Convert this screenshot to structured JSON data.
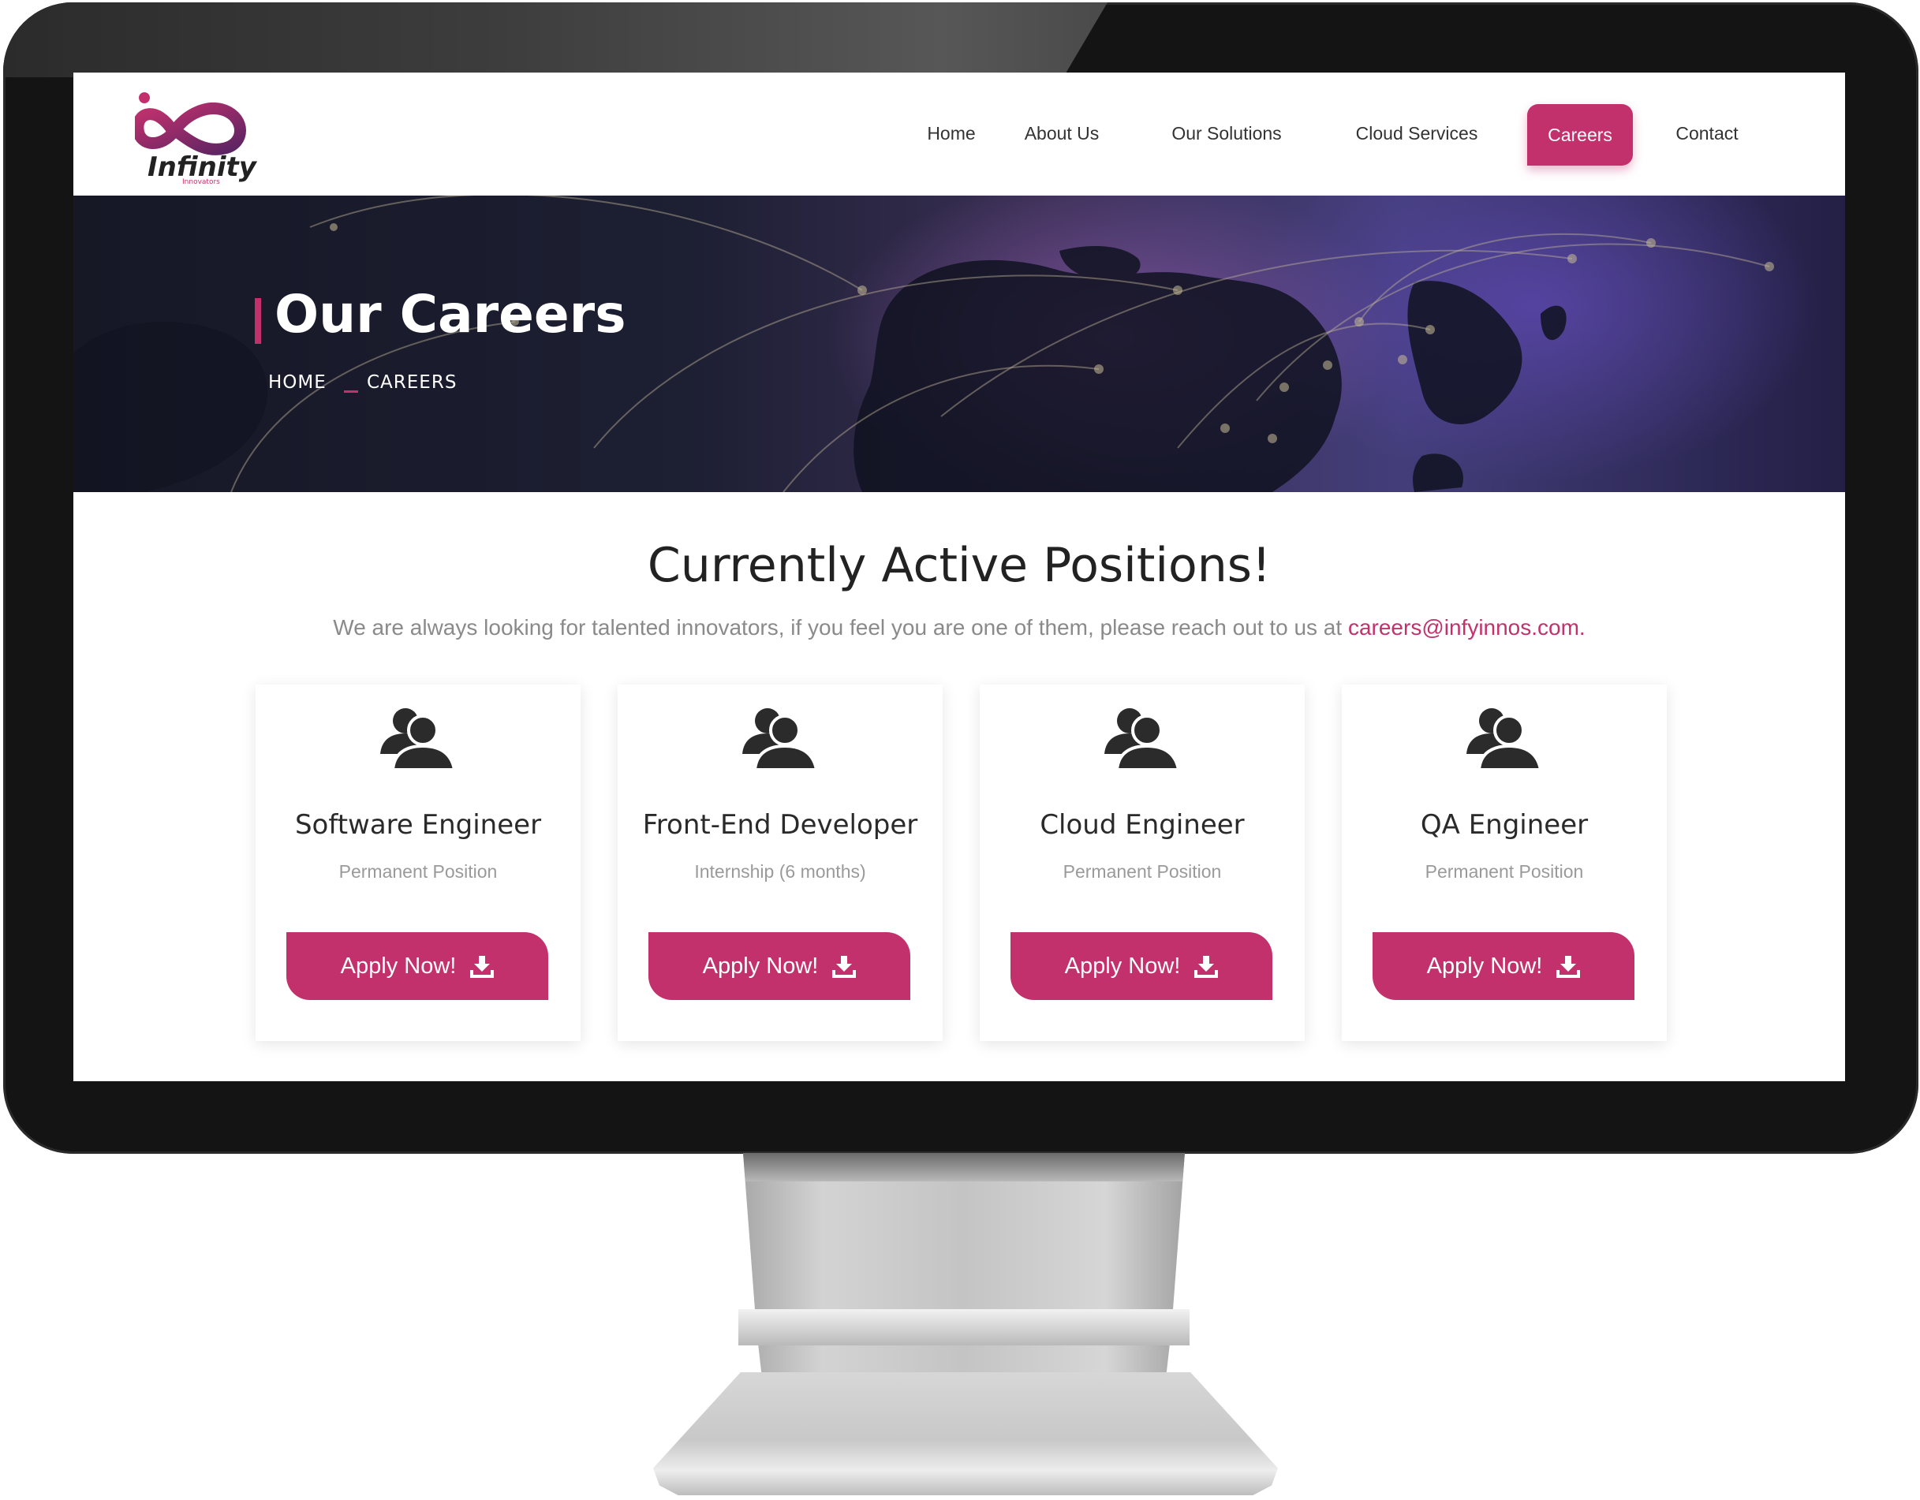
{
  "brand": {
    "name": "Infinity",
    "tagline": "Innovators",
    "accent_color": "#c3316d"
  },
  "nav": {
    "items": [
      {
        "label": "Home"
      },
      {
        "label": "About Us"
      },
      {
        "label": "Our Solutions"
      },
      {
        "label": "Cloud Services"
      },
      {
        "label": "Careers"
      },
      {
        "label": "Contact"
      }
    ],
    "active": "Careers"
  },
  "banner": {
    "title": "Our Careers",
    "breadcrumb": [
      "HOME",
      "CAREERS"
    ]
  },
  "positions_section": {
    "title": "Currently Active Positions!",
    "description": "We are always looking for talented innovators, if you feel you are one of them, please reach out to us at ",
    "email": "careers@infyinnos.com."
  },
  "positions": [
    {
      "title": "Software Engineer",
      "type": "Permanent Position",
      "button": "Apply Now!",
      "icon": "user-icon"
    },
    {
      "title": "Front-End Developer",
      "type": "Internship (6 months)",
      "button": "Apply Now!",
      "icon": "user-icon"
    },
    {
      "title": "Cloud Engineer",
      "type": "Permanent Position",
      "button": "Apply Now!",
      "icon": "user-icon"
    },
    {
      "title": "QA Engineer",
      "type": "Permanent Position",
      "button": "Apply Now!",
      "icon": "user-icon"
    }
  ]
}
